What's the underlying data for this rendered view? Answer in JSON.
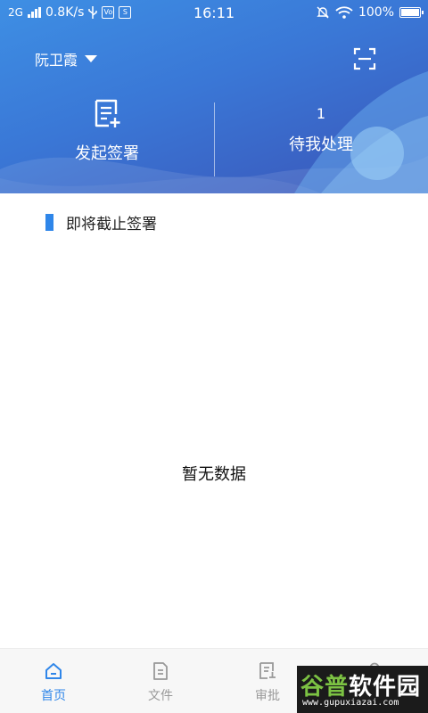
{
  "status_bar": {
    "network": "2G",
    "speed": "0.8K/s",
    "icon_vc": "Vo",
    "icon_s": "S",
    "time": "16:11",
    "battery": "100%"
  },
  "header": {
    "user_name": "阮卫霞",
    "actions": {
      "start_sign_label": "发起签署",
      "pending_count": "1",
      "pending_label": "待我处理"
    }
  },
  "main": {
    "section_title": "即将截止签署",
    "empty_text": "暂无数据"
  },
  "tab_bar": {
    "tabs": [
      {
        "label": "首页",
        "icon": "home-icon",
        "active": true
      },
      {
        "label": "文件",
        "icon": "file-icon",
        "active": false
      },
      {
        "label": "审批",
        "icon": "approval-icon",
        "active": false
      },
      {
        "label": "",
        "icon": "profile-icon",
        "active": false
      }
    ]
  },
  "watermark": {
    "part1": "谷普",
    "part2": "软件园",
    "url": "www.gupuxiazai.com"
  },
  "colors": {
    "accent": "#2f86e9",
    "header_start": "#3e8fe4",
    "header_end": "#3a55b8"
  }
}
